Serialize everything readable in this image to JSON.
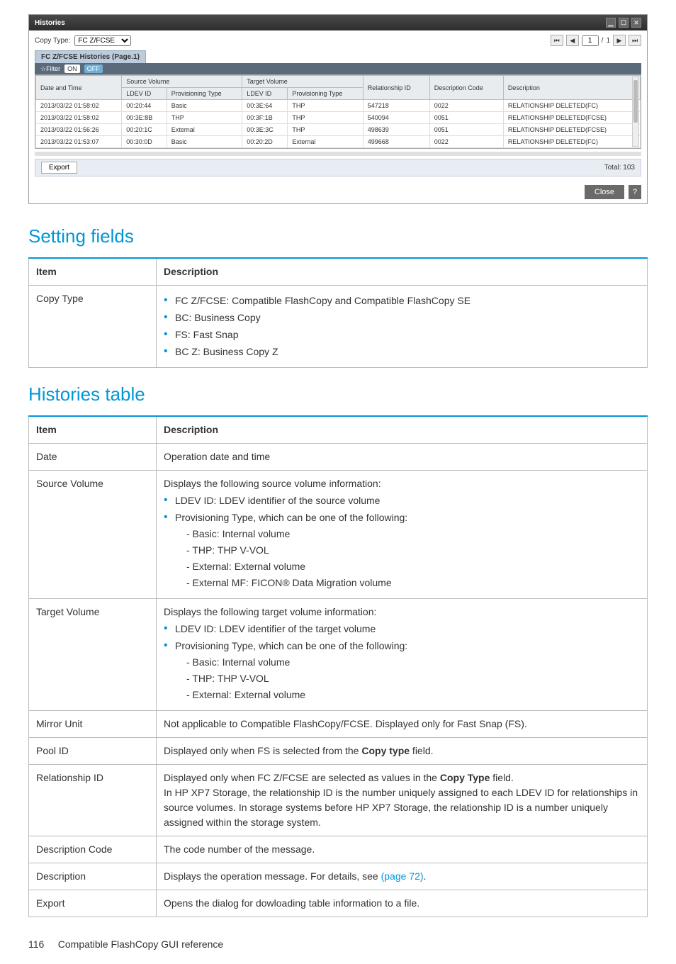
{
  "window": {
    "title": "Histories",
    "copyTypeLabel": "Copy Type:",
    "copyTypeValue": "FC Z/FCSE",
    "paneTab": "FC Z/FCSE Histories (Page.1)",
    "filterLabel": "☆Filter",
    "filterOn": "ON",
    "filterOff": "OFF",
    "pager": {
      "page": "1",
      "sep": "/",
      "total": "1"
    },
    "headers": {
      "dateTime": "Date and Time",
      "sourceVolume": "Source Volume",
      "targetVolume": "Target Volume",
      "ldevId": "LDEV ID",
      "provType": "Provisioning Type",
      "relId": "Relationship ID",
      "descCode": "Description Code",
      "description": "Description"
    },
    "rows": [
      {
        "dt": "2013/03/22 01:58:02",
        "sLdev": "00:20:44",
        "sType": "Basic",
        "tLdev": "00:3E:64",
        "tType": "THP",
        "rel": "547218",
        "code": "0022",
        "desc": "RELATIONSHIP DELETED(FC)"
      },
      {
        "dt": "2013/03/22 01:58:02",
        "sLdev": "00:3E:8B",
        "sType": "THP",
        "tLdev": "00:3F:1B",
        "tType": "THP",
        "rel": "540094",
        "code": "0051",
        "desc": "RELATIONSHIP DELETED(FCSE)"
      },
      {
        "dt": "2013/03/22 01:56:26",
        "sLdev": "00:20:1C",
        "sType": "External",
        "tLdev": "00:3E:3C",
        "tType": "THP",
        "rel": "498639",
        "code": "0051",
        "desc": "RELATIONSHIP DELETED(FCSE)"
      },
      {
        "dt": "2013/03/22 01:53:07",
        "sLdev": "00:30:0D",
        "sType": "Basic",
        "tLdev": "00:20:2D",
        "tType": "External",
        "rel": "499668",
        "code": "0022",
        "desc": "RELATIONSHIP DELETED(FC)"
      }
    ],
    "exportLabel": "Export",
    "totalLabel": "Total: 103",
    "closeLabel": "Close",
    "helpLabel": "?"
  },
  "section1Title": "Setting fields",
  "table1": {
    "header": {
      "c1": "Item",
      "c2": "Description"
    },
    "row1": {
      "item": "Copy Type",
      "b1": "FC Z/FCSE: Compatible FlashCopy and Compatible FlashCopy SE",
      "b2": "BC: Business Copy",
      "b3": "FS: Fast Snap",
      "b4": "BC Z: Business Copy Z"
    }
  },
  "section2Title": "Histories table",
  "table2": {
    "header": {
      "c1": "Item",
      "c2": "Description"
    },
    "rDate": {
      "item": "Date",
      "desc": "Operation date and time"
    },
    "rSource": {
      "item": "Source Volume",
      "intro": "Displays the following source volume information:",
      "b1": "LDEV ID: LDEV identifier of the source volume",
      "b2": "Provisioning Type, which can be one of the following:",
      "s1": "- Basic: Internal volume",
      "s2": "- THP: THP V-VOL",
      "s3": "- External: External volume",
      "s4": "- External MF: FICON® Data Migration volume"
    },
    "rTarget": {
      "item": "Target Volume",
      "intro": "Displays the following target volume information:",
      "b1": "LDEV ID: LDEV identifier of the target volume",
      "b2": "Provisioning Type, which can be one of the following:",
      "s1": "- Basic: Internal volume",
      "s2": "- THP: THP V-VOL",
      "s3": "- External: External volume"
    },
    "rMirror": {
      "item": "Mirror Unit",
      "desc": "Not applicable to Compatible FlashCopy/FCSE. Displayed only for Fast Snap (FS)."
    },
    "rPool": {
      "item": "Pool ID",
      "d1": "Displayed only when FS is selected from the ",
      "bold": "Copy type",
      "d2": " field."
    },
    "rRel": {
      "item": "Relationship ID",
      "d1": "Displayed only when FC Z/FCSE are selected as values in the ",
      "bold": "Copy Type",
      "d2": " field.",
      "p2": "In HP XP7 Storage, the relationship ID is the number uniquely assigned to each LDEV ID for relationships in source volumes. In storage systems before HP XP7 Storage, the relationship ID is a number uniquely assigned within the storage system."
    },
    "rCode": {
      "item": "Description Code",
      "desc": "The code number of the message."
    },
    "rDesc": {
      "item": "Description",
      "d1": "Displays the operation message. For details, see ",
      "link": "(page 72)",
      "d2": "."
    },
    "rExport": {
      "item": "Export",
      "desc": "Opens the dialog for dowloading table information to a file."
    }
  },
  "footer": {
    "pageNum": "116",
    "text": "Compatible FlashCopy GUI reference"
  }
}
